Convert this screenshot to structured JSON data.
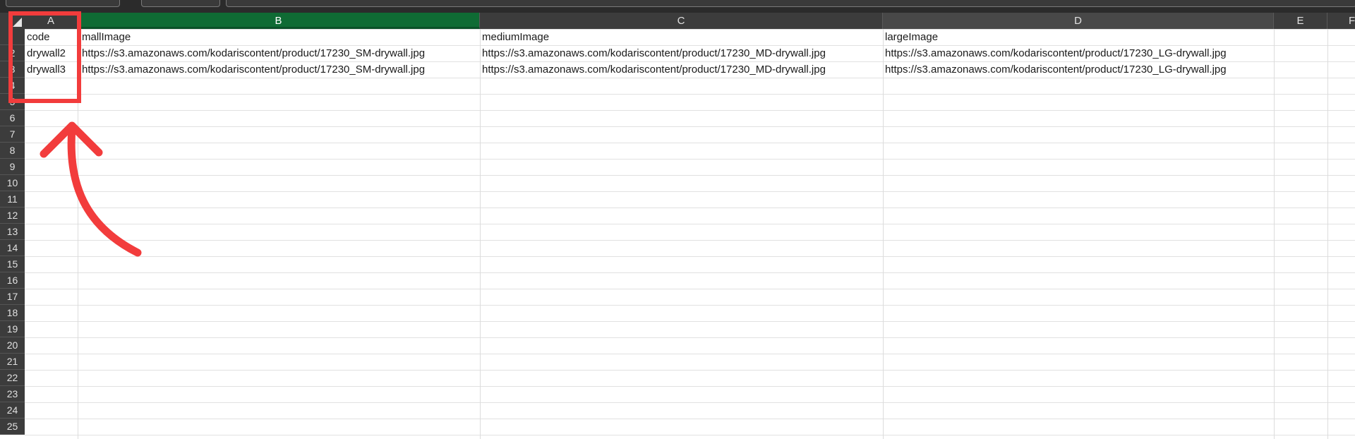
{
  "columns": [
    {
      "label": "A"
    },
    {
      "label": "B"
    },
    {
      "label": "C"
    },
    {
      "label": "D"
    },
    {
      "label": "E"
    },
    {
      "label": "F"
    }
  ],
  "rows": [
    "2",
    "3",
    "4",
    "5",
    "6",
    "7",
    "8",
    "9",
    "10",
    "11",
    "12",
    "13",
    "14",
    "15",
    "16",
    "17",
    "18",
    "19",
    "20",
    "21",
    "22",
    "23",
    "24",
    "25"
  ],
  "cells": {
    "r1": {
      "a": "code",
      "b": "mallImage",
      "c": "mediumImage",
      "d": "largeImage"
    },
    "r2": {
      "a": "drywall2",
      "b": "https://s3.amazonaws.com/kodariscontent/product/17230_SM-drywall.jpg",
      "c": "https://s3.amazonaws.com/kodariscontent/product/17230_MD-drywall.jpg",
      "d": "https://s3.amazonaws.com/kodariscontent/product/17230_LG-drywall.jpg"
    },
    "r3": {
      "a": "drywall3",
      "b": "https://s3.amazonaws.com/kodariscontent/product/17230_SM-drywall.jpg",
      "c": "https://s3.amazonaws.com/kodariscontent/product/17230_MD-drywall.jpg",
      "d": "https://s3.amazonaws.com/kodariscontent/product/17230_LG-drywall.jpg"
    }
  },
  "colors": {
    "selected_column": "#0f6b34",
    "header_bg": "#3c3c3c",
    "annotation": "#f23c3c"
  },
  "icons": {
    "select_all": "select-all-triangle-icon",
    "annotation_arrow": "curved-arrow-icon"
  }
}
